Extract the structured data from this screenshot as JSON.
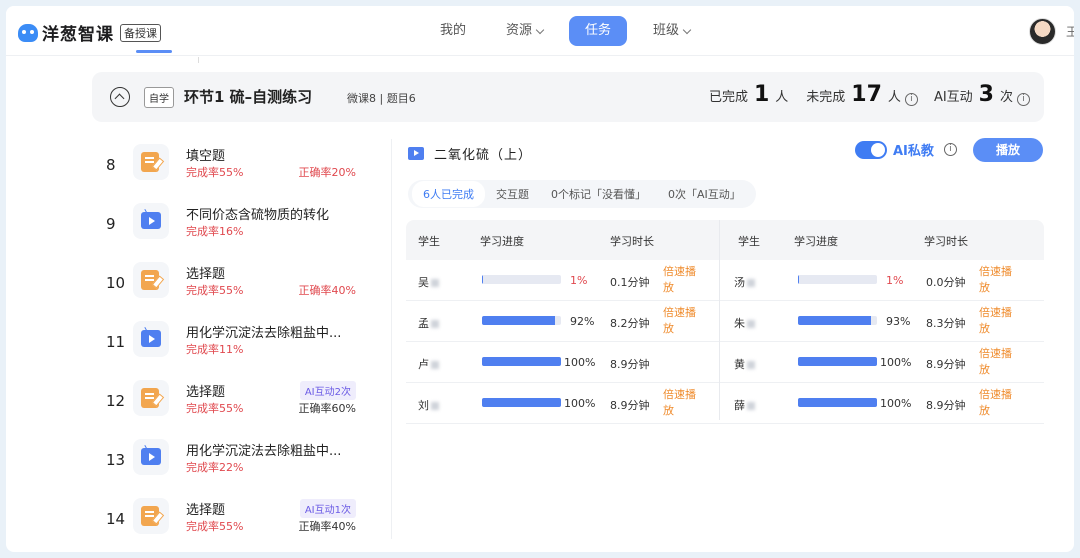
{
  "brand": {
    "name": "洋葱智课",
    "badge": "备授课"
  },
  "nav": {
    "items": [
      {
        "label": "我的",
        "chev": false
      },
      {
        "label": "资源",
        "chev": true
      },
      {
        "label": "任务",
        "chev": false,
        "active": true
      },
      {
        "label": "班级",
        "chev": true
      }
    ]
  },
  "user": {
    "name": "王"
  },
  "section": {
    "tag": "自学",
    "title": "环节1   硫–自测练习",
    "meta": "微课8 | 题目6",
    "done_label": "已完成",
    "done_num": "1",
    "done_unit": "人",
    "undone_label": "未完成",
    "undone_num": "17",
    "undone_unit": "人",
    "ai_label": "AI互动",
    "ai_num": "3",
    "ai_unit": "次"
  },
  "left_items": [
    {
      "num": "8",
      "type": "edit",
      "title": "填空题",
      "rate": "完成率55%",
      "acc": "正确率20%",
      "acc_plain": false,
      "ai": ""
    },
    {
      "num": "9",
      "type": "video",
      "title": "不同价态含硫物质的转化",
      "rate": "完成率16%",
      "acc": "",
      "acc_plain": false,
      "ai": ""
    },
    {
      "num": "10",
      "type": "edit",
      "title": "选择题",
      "rate": "完成率55%",
      "acc": "正确率40%",
      "acc_plain": false,
      "ai": ""
    },
    {
      "num": "11",
      "type": "video",
      "title": "用化学沉淀法去除粗盐中...",
      "rate": "完成率11%",
      "acc": "",
      "acc_plain": false,
      "ai": ""
    },
    {
      "num": "12",
      "type": "edit",
      "title": "选择题",
      "rate": "完成率55%",
      "acc": "正确率60%",
      "acc_plain": true,
      "ai": "AI互动2次"
    },
    {
      "num": "13",
      "type": "video",
      "title": "用化学沉淀法去除粗盐中...",
      "rate": "完成率22%",
      "acc": "",
      "acc_plain": false,
      "ai": ""
    },
    {
      "num": "14",
      "type": "edit",
      "title": "选择题",
      "rate": "完成率55%",
      "acc": "正确率40%",
      "acc_plain": true,
      "ai": "AI互动1次"
    }
  ],
  "video": {
    "title": "二氧化硫（上）",
    "ai_tutor": "AI私教",
    "play": "播放"
  },
  "filters": [
    "6人已完成",
    "交互题",
    "0个标记「没看懂」",
    "0次「AI互动」"
  ],
  "table": {
    "headers": [
      "学生",
      "学习进度",
      "学习时长",
      "学生",
      "学习进度",
      "学习时长"
    ],
    "rows": [
      {
        "l": {
          "name": "吴",
          "progress": 0.01,
          "pct": "1%",
          "low": true,
          "dur": "0.1分钟",
          "speed": "倍速播放"
        },
        "r": {
          "name": "汤",
          "progress": 0.01,
          "pct": "1%",
          "low": true,
          "dur": "0.0分钟",
          "speed": "倍速播放"
        }
      },
      {
        "l": {
          "name": "孟",
          "progress": 0.92,
          "pct": "92%",
          "low": false,
          "dur": "8.2分钟",
          "speed": "倍速播放"
        },
        "r": {
          "name": "朱",
          "progress": 0.93,
          "pct": "93%",
          "low": false,
          "dur": "8.3分钟",
          "speed": "倍速播放"
        }
      },
      {
        "l": {
          "name": "卢",
          "progress": 1.0,
          "pct": "100%",
          "low": false,
          "dur": "8.9分钟",
          "speed": ""
        },
        "r": {
          "name": "黄",
          "progress": 1.0,
          "pct": "100%",
          "low": false,
          "dur": "8.9分钟",
          "speed": "倍速播放"
        }
      },
      {
        "l": {
          "name": "刘",
          "progress": 1.0,
          "pct": "100%",
          "low": false,
          "dur": "8.9分钟",
          "speed": "倍速播放"
        },
        "r": {
          "name": "薛",
          "progress": 1.0,
          "pct": "100%",
          "low": false,
          "dur": "8.9分钟",
          "speed": "倍速播放"
        }
      }
    ]
  }
}
